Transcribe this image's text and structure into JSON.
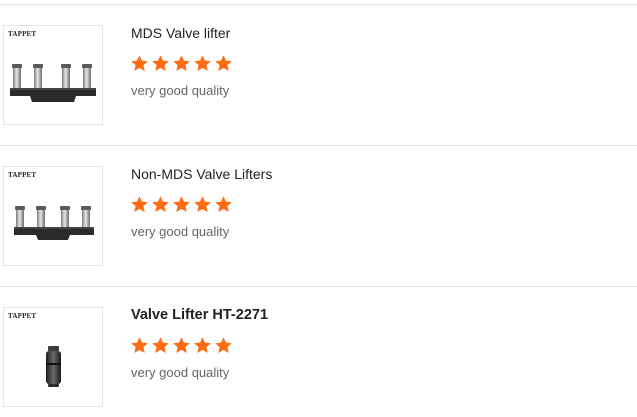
{
  "colors": {
    "star": "#ff6a13",
    "divider": "#e3e3e3",
    "title_text": "#222222",
    "comment_text": "#666666"
  },
  "reviews": [
    {
      "image_caption": "TAPPET",
      "image_icon": "mds-valve-lifter-assembly-icon",
      "title": "MDS Valve lifter",
      "rating": 5,
      "comment": "very good quality"
    },
    {
      "image_caption": "TAPPET",
      "image_icon": "non-mds-valve-lifter-assembly-icon",
      "title": "Non-MDS Valve Lifters",
      "rating": 5,
      "comment": "very good quality"
    },
    {
      "image_caption": "TAPPET",
      "image_icon": "single-valve-lifter-icon",
      "title": "Valve Lifter HT-2271",
      "rating": 5,
      "comment": "very good quality"
    }
  ]
}
